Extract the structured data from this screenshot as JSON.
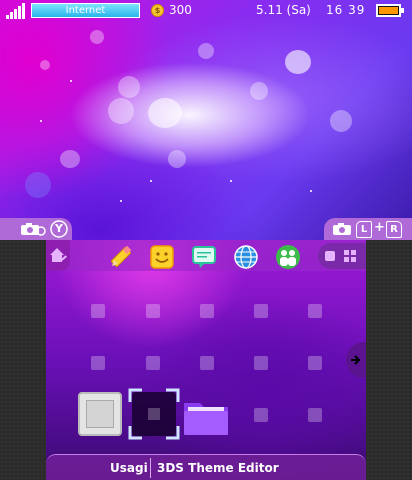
{
  "status_bar": {
    "network_label": "Internet",
    "coin_symbol": "$",
    "coin_count": "300",
    "date": "5.11 (Sa)",
    "time": "16 39"
  },
  "top_screen": {
    "camera_icon": "camera-icon",
    "y_button_label": "Y",
    "l_button_label": "L",
    "plus_label": "+",
    "r_button_label": "R"
  },
  "bottom_screen": {
    "toolbar_icons": [
      "home-settings-icon",
      "pencil-icon",
      "smiley-icon",
      "speech-bubble-icon",
      "globe-icon",
      "friends-icon"
    ],
    "current_app": {
      "user": "Usagi",
      "title": "3DS Theme Editor"
    }
  },
  "colors": {
    "accent": "#b06ad8",
    "battery": "#ff9800",
    "network": "#27b5ea"
  }
}
